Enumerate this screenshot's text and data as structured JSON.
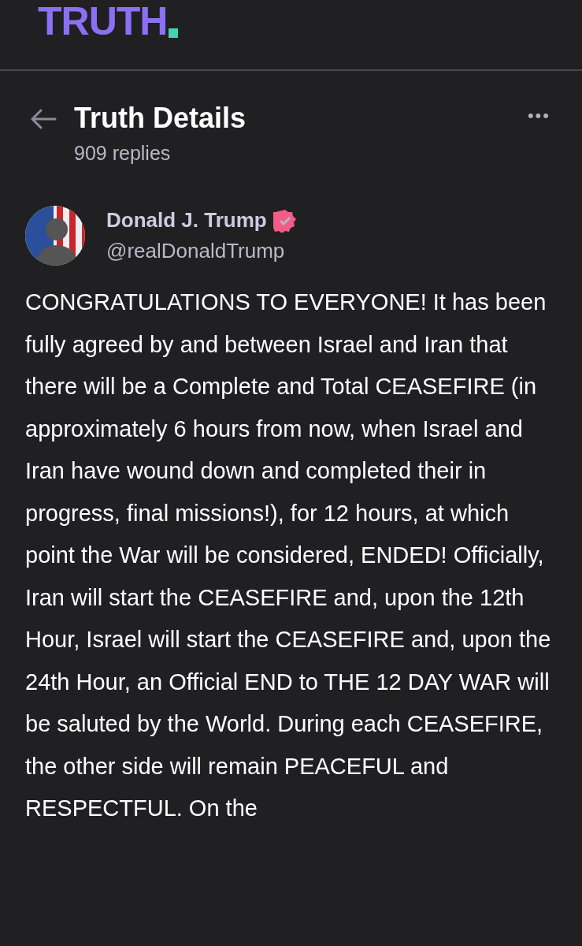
{
  "logo": {
    "text": "TRUTH"
  },
  "header": {
    "title": "Truth Details",
    "subtitle": "909 replies",
    "more": "•••"
  },
  "post": {
    "author": "Donald J. Trump",
    "verified": true,
    "handle": "@realDonaldTrump",
    "body": "CONGRATULATIONS TO EVERYONE! It has been fully agreed by and between Israel and Iran that there will be a Complete and Total CEASEFIRE (in approximately 6 hours from now, when Israel and Iran have wound down and completed their in progress, final missions!), for 12 hours, at which point the War will be considered, ENDED! Officially, Iran will start the CEASEFIRE and, upon the 12th Hour, Israel will start the CEASEFIRE and, upon the 24th Hour, an Official END to THE 12 DAY WAR will be saluted by the World. During each CEASEFIRE, the other side will remain PEACEFUL and RESPECTFUL. On the"
  }
}
